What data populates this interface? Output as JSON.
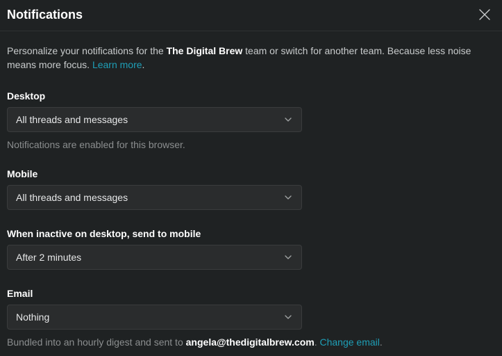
{
  "header": {
    "title": "Notifications"
  },
  "intro": {
    "pre": "Personalize your notifications for the ",
    "team": "The Digital Brew",
    "post": " team or switch for another team. Because less noise means more focus. ",
    "learn_more": "Learn more",
    "period": "."
  },
  "desktop": {
    "label": "Desktop",
    "value": "All threads and messages",
    "helper": "Notifications are enabled for this browser."
  },
  "mobile": {
    "label": "Mobile",
    "value": "All threads and messages"
  },
  "inactive": {
    "label": "When inactive on desktop, send to mobile",
    "value": "After 2 minutes"
  },
  "email": {
    "label": "Email",
    "value": "Nothing",
    "helper_pre": "Bundled into an hourly digest and sent to ",
    "helper_email": "angela@thedigitalbrew.com",
    "helper_mid": ". ",
    "change_email": "Change email",
    "helper_end": "."
  }
}
